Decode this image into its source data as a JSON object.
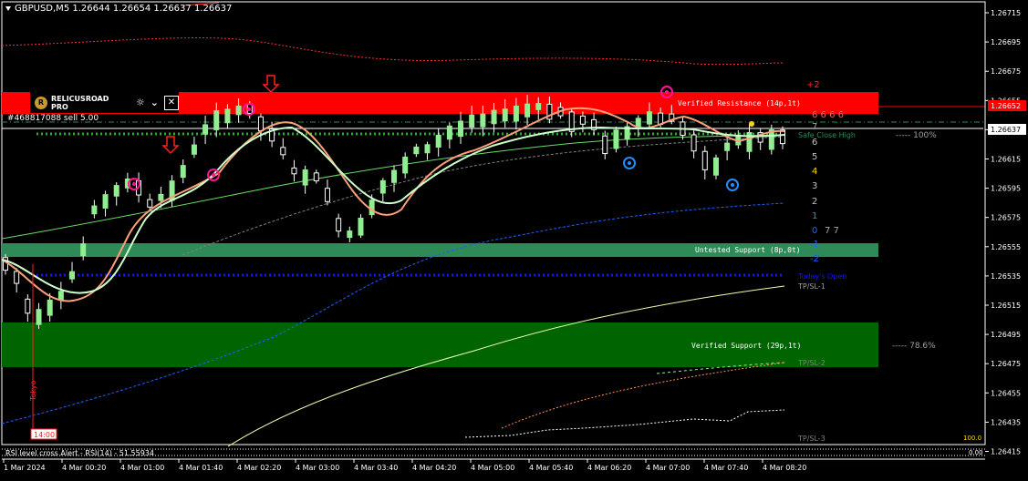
{
  "window": {
    "symbol_line": "GBPUSD,M5  1.26644 1.26654 1.26637 1.26637"
  },
  "trade": {
    "label": "#468817088 sell 5.00"
  },
  "indicator_panel": {
    "name": "RELICUSROAD PRO",
    "logo_glyph": "R",
    "icons": [
      "sun-icon",
      "chevron-down-icon",
      "close-icon"
    ]
  },
  "zones": {
    "resistance_label": "Verified Resistance (14p,1t)",
    "untested_label": "Untested Support (8p,0t)",
    "support_label": "Verified Support (29p,1t)"
  },
  "levels": {
    "safe_close": "Safe Close High",
    "todays_open": "Today's Open",
    "tp_sl_1": "TP/SL-1",
    "tp_sl_2": "TP/SL-2",
    "tp_sl_3": "TP/SL-3",
    "pct_100": "----- 100%",
    "pct_786": "----- 78.6%"
  },
  "numbers_column": {
    "plus2": "+2",
    "row_a": "6  6  6  6",
    "row_b": "7",
    "row_c": "6",
    "row_d": "5",
    "row_e": "4",
    "row_f": "3",
    "row_g": "2",
    "row_h": "1",
    "row_i": "0",
    "row_i_extra": "7  7",
    "minus1": "-1",
    "minus2": "-2"
  },
  "time_marker": "14:00",
  "vertical_label": "Tokyo",
  "bottom_alert": "RSI level cross Alert - RSI(14) - 51.55934",
  "price_axis": {
    "ticks": [
      "1.26715",
      "1.26695",
      "1.26675",
      "1.26655",
      "1.26635",
      "1.26615",
      "1.26595",
      "1.26575",
      "1.26555",
      "1.26535",
      "1.26515",
      "1.26495",
      "1.26475",
      "1.26455",
      "1.26435",
      "1.26415"
    ],
    "resistance_tag": "1.26652",
    "current_tag": "1.26637",
    "scale_tag_top": "100.0",
    "scale_tag_bottom": "0.00"
  },
  "time_axis": {
    "labels": [
      "1 Mar 2024",
      "4 Mar 00:20",
      "4 Mar 01:00",
      "4 Mar 01:40",
      "4 Mar 02:20",
      "4 Mar 03:00",
      "4 Mar 03:40",
      "4 Mar 04:20",
      "4 Mar 05:00",
      "4 Mar 05:40",
      "4 Mar 06:20",
      "4 Mar 07:00",
      "4 Mar 07:40",
      "4 Mar 08:20"
    ]
  },
  "colors": {
    "background": "#000000",
    "resistance": "#ff0000",
    "untested_support": "#2e8b57",
    "verified_support": "#006400",
    "bull_candle": "#90ee90",
    "bear_candle": "#ffffff",
    "ma_fast": "#ffa07a",
    "ma_slow": "#90ee90",
    "accent_blue": "#1e90ff",
    "marker_magenta": "#ff1493"
  }
}
